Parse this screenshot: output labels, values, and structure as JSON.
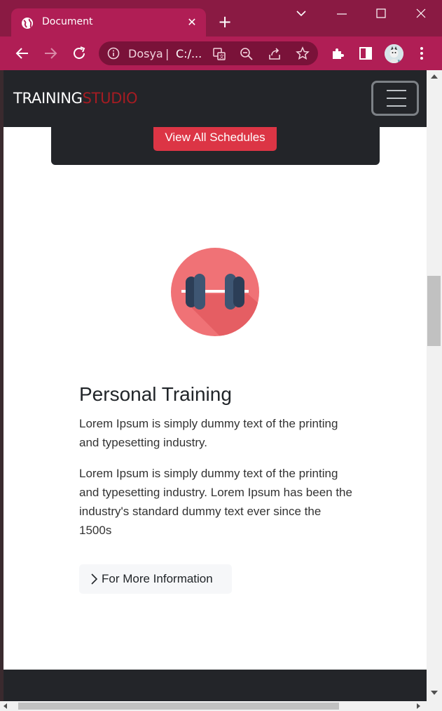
{
  "browser": {
    "tab_title": "Document",
    "omnibox": {
      "site_label": "Dosya",
      "separator": "|",
      "url": "C:/..."
    }
  },
  "page": {
    "brand": {
      "part1": "TRAINING",
      "part2": "STUDIO"
    },
    "schedule_button": "View All Schedules",
    "personal_training": {
      "title": "Personal Training",
      "text1": "Lorem Ipsum is simply dummy text of the printing and typesetting industry.",
      "text2": "Lorem Ipsum is simply dummy text of the printing and typesetting industry. Lorem Ipsum has been the industry's standard dummy text ever since the 1500s",
      "button": "For More Information"
    }
  },
  "colors": {
    "chrome_tabbar": "#8a1a43",
    "chrome_toolbar": "#b01e55",
    "navbar": "#232529",
    "brand_accent": "#a51c22",
    "primary_button": "#dc3545",
    "icon_circle": "#f07276"
  }
}
